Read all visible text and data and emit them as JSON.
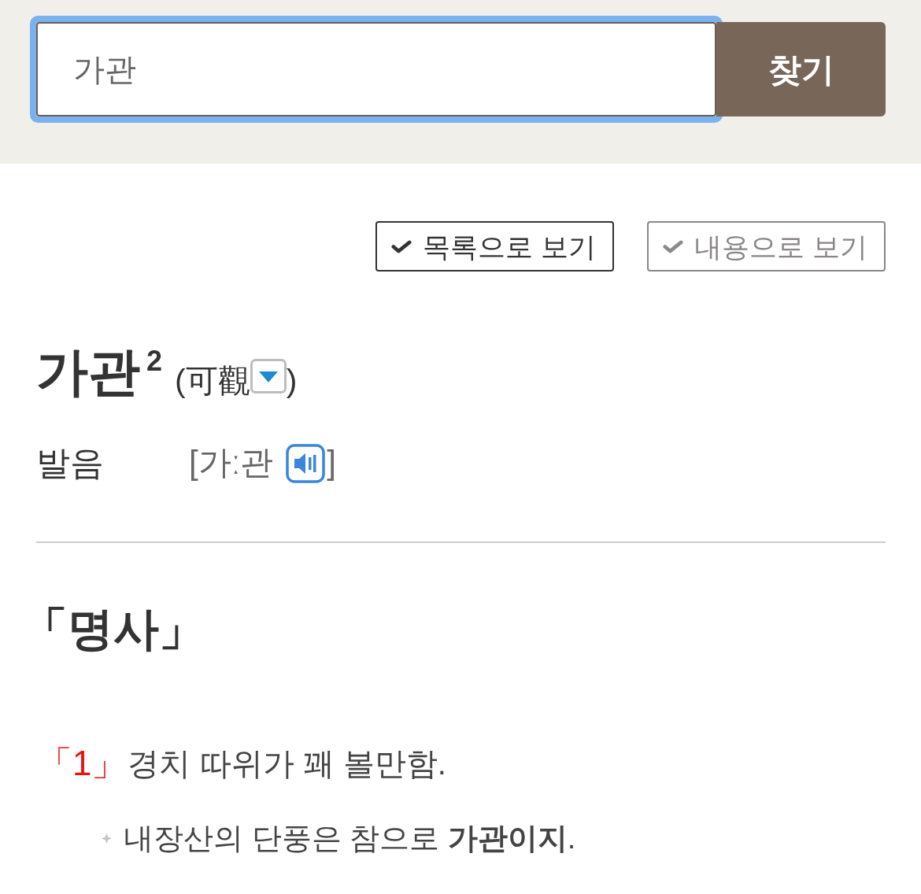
{
  "search": {
    "value": "가관",
    "focused": true,
    "button": "찾기"
  },
  "view_toggles": [
    {
      "label": "목록으로 보기",
      "selected": true
    },
    {
      "label": "내용으로 보기",
      "selected": false
    }
  ],
  "entry": {
    "headword": "가관",
    "homograph": "2",
    "origin_open": "(可觀",
    "origin_close": ")",
    "pronunciation": {
      "label": "발음",
      "value_open": "[가ː관",
      "value_close": "]"
    }
  },
  "part_of_speech": "「명사」",
  "senses": [
    {
      "number": "「1」",
      "definition": "경치 따위가 꽤 볼만함.",
      "examples": [
        "내장산의 단풍은 참으로 **가관이지**."
      ]
    }
  ]
}
